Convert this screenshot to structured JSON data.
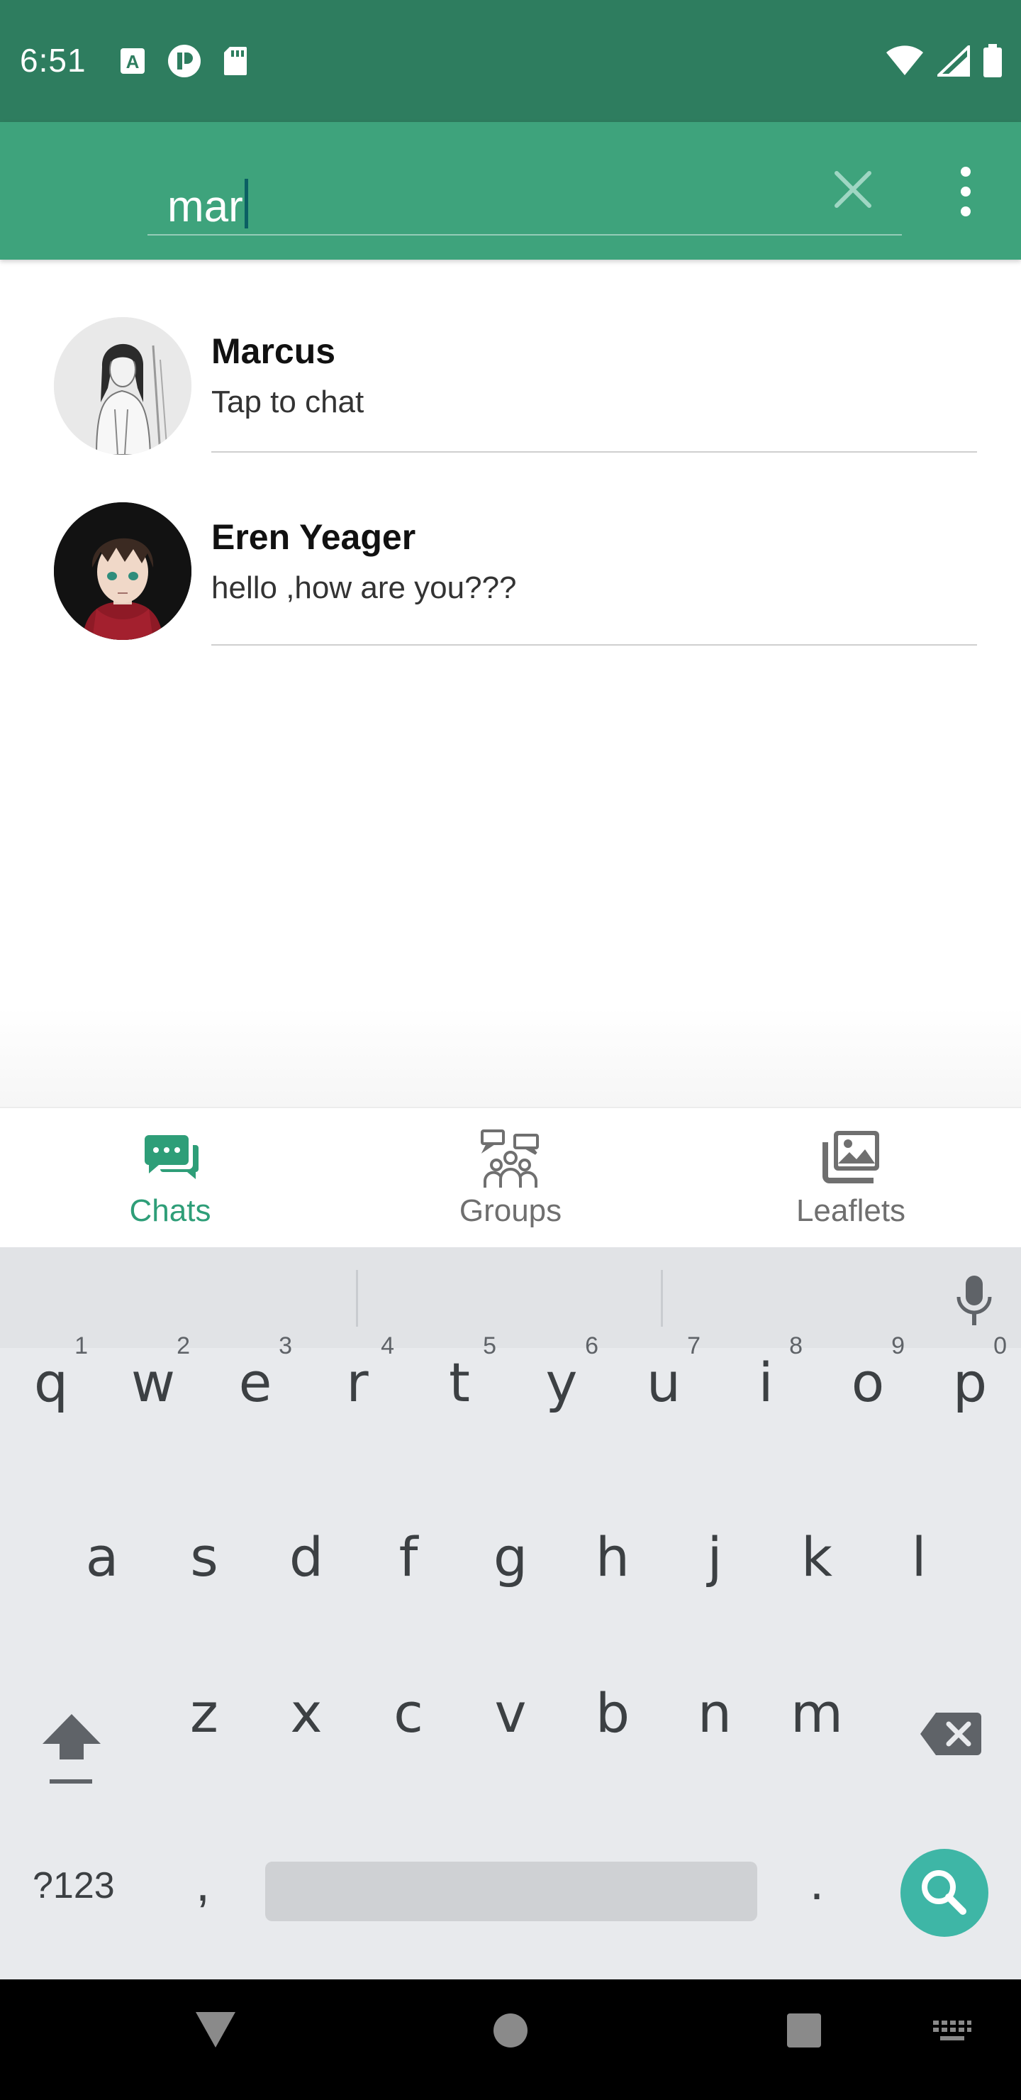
{
  "status_bar": {
    "time": "6:51",
    "left_icons": [
      "a-letter-icon",
      "p-badge-icon",
      "sd-card-icon"
    ],
    "right_icons": [
      "wifi-icon",
      "signal-icon",
      "battery-icon"
    ]
  },
  "search": {
    "query": "mar",
    "clear_icon": "close-icon",
    "menu_icon": "more-vert-icon"
  },
  "chats": [
    {
      "name": "Marcus",
      "message": "Tap to chat",
      "avatar": "sketch-portrait"
    },
    {
      "name": "Eren Yeager",
      "message": "hello ,how are you???",
      "avatar": "anime-portrait"
    }
  ],
  "bottom_nav": {
    "items": [
      {
        "label": "Chats",
        "icon": "chat-bubbles-icon",
        "active": true
      },
      {
        "label": "Groups",
        "icon": "group-people-icon",
        "active": false
      },
      {
        "label": "Leaflets",
        "icon": "image-gallery-icon",
        "active": false
      }
    ],
    "active_color": "#2e9e78"
  },
  "keyboard": {
    "row1": [
      {
        "key": "q",
        "hint": "1"
      },
      {
        "key": "w",
        "hint": "2"
      },
      {
        "key": "e",
        "hint": "3"
      },
      {
        "key": "r",
        "hint": "4"
      },
      {
        "key": "t",
        "hint": "5"
      },
      {
        "key": "y",
        "hint": "6"
      },
      {
        "key": "u",
        "hint": "7"
      },
      {
        "key": "i",
        "hint": "8"
      },
      {
        "key": "o",
        "hint": "9"
      },
      {
        "key": "p",
        "hint": "0"
      }
    ],
    "row2": [
      "a",
      "s",
      "d",
      "f",
      "g",
      "h",
      "j",
      "k",
      "l"
    ],
    "row3": [
      "z",
      "x",
      "c",
      "v",
      "b",
      "n",
      "m"
    ],
    "symbols_label": "?123",
    "comma": ",",
    "period": ".",
    "action_icon": "search-icon"
  },
  "colors": {
    "status_bar": "#2e7d5f",
    "app_bar": "#3ea37c",
    "search_key": "#3eb6a6"
  }
}
